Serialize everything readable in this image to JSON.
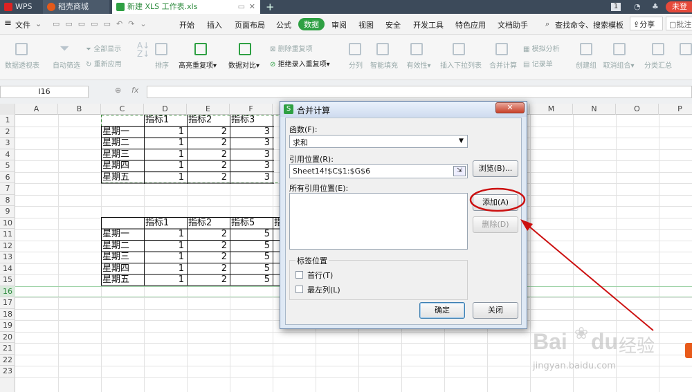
{
  "tabs": {
    "wps": "WPS",
    "store": "稻壳商城",
    "doc": "新建 XLS 工作表.xls",
    "badge": "1",
    "user": "未登"
  },
  "menu": {
    "file": "文件",
    "items": [
      "开始",
      "插入",
      "页面布局",
      "公式",
      "数据",
      "审阅",
      "视图",
      "安全",
      "开发工具",
      "特色应用",
      "文档助手"
    ],
    "search": "查找命令、搜索模板",
    "share": "分享",
    "annotate": "批注"
  },
  "ribbon": {
    "pivot": "数据透视表",
    "autofilter": "自动筛选",
    "show_all": "全部显示",
    "reapply": "重新应用",
    "sort": "排序",
    "highlight_dup": "高亮重复项",
    "data_compare": "数据对比",
    "delete_dup": "删除重复项",
    "reject_dup": "拒绝录入重复项",
    "split": "分列",
    "smart_fill": "智能填充",
    "validity": "有效性",
    "dropdown": "插入下拉列表",
    "consolidate": "合并计算",
    "simulate": "模拟分析",
    "record": "记录单",
    "group": "创建组",
    "ungroup": "取消组合",
    "subtotal": "分类汇总"
  },
  "formula_bar": {
    "name_box": "I16",
    "fx": "fx",
    "value": ""
  },
  "sheet": {
    "columns": [
      "A",
      "B",
      "C",
      "D",
      "E",
      "F",
      "G",
      "H",
      "I",
      "J",
      "K",
      "L",
      "M",
      "N",
      "O",
      "P"
    ],
    "rows": [
      "1",
      "2",
      "3",
      "4",
      "5",
      "6",
      "7",
      "8",
      "9",
      "10",
      "11",
      "12",
      "13",
      "14",
      "15",
      "16",
      "17",
      "18",
      "19",
      "20",
      "21",
      "22",
      "23"
    ],
    "active_row": "16",
    "table1": {
      "headers": [
        "指标1",
        "指标2",
        "指标3"
      ],
      "rows": [
        [
          "星期一",
          "1",
          "2",
          "3"
        ],
        [
          "星期二",
          "1",
          "2",
          "3"
        ],
        [
          "星期三",
          "1",
          "2",
          "3"
        ],
        [
          "星期四",
          "1",
          "2",
          "3"
        ],
        [
          "星期五",
          "1",
          "2",
          "3"
        ]
      ]
    },
    "table2": {
      "headers": [
        "指标1",
        "指标2",
        "指标5",
        "指"
      ],
      "rows": [
        [
          "星期一",
          "1",
          "2",
          "5"
        ],
        [
          "星期二",
          "1",
          "2",
          "5"
        ],
        [
          "星期三",
          "1",
          "2",
          "5"
        ],
        [
          "星期四",
          "1",
          "2",
          "5"
        ],
        [
          "星期五",
          "1",
          "2",
          "5"
        ]
      ]
    }
  },
  "dialog": {
    "title": "合并计算",
    "function_label": "函数(F):",
    "function_value": "求和",
    "ref_label": "引用位置(R):",
    "ref_value": "Sheet14!$C$1:$G$6",
    "browse": "浏览(B)...",
    "all_refs_label": "所有引用位置(E):",
    "add": "添加(A)",
    "delete": "删除(D)",
    "label_pos": "标签位置",
    "first_row": "首行(T)",
    "left_col": "最左列(L)",
    "ok": "确定",
    "close": "关闭"
  },
  "watermark": {
    "brand": "Bai",
    "brand2": "du",
    "jingyan": "经验",
    "url": "jingyan.baidu.com"
  },
  "colors": {
    "accent_green": "#2ea043",
    "annotation_red": "#cc1111",
    "dialog_frame": "#dfe9f5"
  }
}
